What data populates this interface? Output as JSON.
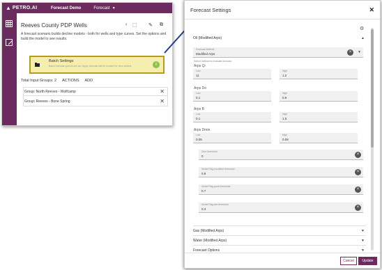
{
  "app": {
    "logo_mark": "▲",
    "logo_text": "PETRO.AI",
    "nav_link": "Forecast Demo",
    "nav_menu": "Forecast",
    "nav_caret": "▼"
  },
  "sidebar": {
    "items": [
      {
        "icon": "grid-icon"
      },
      {
        "icon": "edit-icon"
      }
    ]
  },
  "panel": {
    "title": "Reeves County PDP Wells",
    "icons": [
      "chevron-left-icon",
      "export-icon",
      "pencil-icon",
      "open-external-icon"
    ],
    "icon_glyphs": [
      "‹",
      "⬚",
      "✎",
      "⧉"
    ],
    "description": "A forecast scenario builds decline models - both for wells and type curves. Set the options and build the model to see results.",
    "batch": {
      "title": "Batch Settings",
      "subtitle": "Batch forecast options are set. Apply forecast will be created for new models.",
      "info": "i"
    },
    "totals_label": "Total Input Groups: 2",
    "actions_label": "ACTIONS",
    "add_label": "ADD",
    "groups": [
      {
        "label": "Group: North Reeves - Wolfcamp",
        "close": "✕"
      },
      {
        "label": "Group: Reeves - Bone Spring",
        "close": "✕"
      }
    ]
  },
  "modal": {
    "title": "Forecast Settings",
    "close": "✕",
    "gear": "⚙",
    "section_oil": "Oil (Modified Arps)",
    "section_oil_caret": "▲",
    "forecast_method_label": "Forecast Method",
    "forecast_method_value": "Modified Arps",
    "method_help": "Select method to evaluate forecast",
    "params": [
      {
        "name": "Arps Qi",
        "low_label": "Low",
        "low": "11",
        "high_label": "High",
        "high": "1.2"
      },
      {
        "name": "Arps Do",
        "low_label": "Low",
        "low": "0.1",
        "high_label": "High",
        "high": "0.9"
      },
      {
        "name": "Arps B",
        "low_label": "Low",
        "low": "0.1",
        "high_label": "High",
        "high": "1.5"
      },
      {
        "name": "Arps Dmin",
        "low_label": "Low",
        "low": "0.05",
        "high_label": "High",
        "high": "0.08"
      }
    ],
    "thresholds": [
      {
        "label": "Zero threshold",
        "value": "0"
      },
      {
        "label": "Model Flag excellent threshold",
        "value": "0.9"
      },
      {
        "label": "Model Flag good threshold",
        "value": "0.7"
      },
      {
        "label": "Model Flag fair threshold",
        "value": "0.3"
      }
    ],
    "collapsed_sections": [
      {
        "label": "Gas (Modified Arps)",
        "caret": "▼"
      },
      {
        "label": "Water (Modified Arps)",
        "caret": "▼"
      },
      {
        "label": "Forecast Options",
        "caret": "▼"
      }
    ],
    "cancel_label": "Cancel",
    "update_label": "Update"
  },
  "colors": {
    "brand": "#6b2b5f",
    "highlight_border": "#b59d1a",
    "highlight_fill": "#f6eeae",
    "info_green": "#8bc34a"
  }
}
